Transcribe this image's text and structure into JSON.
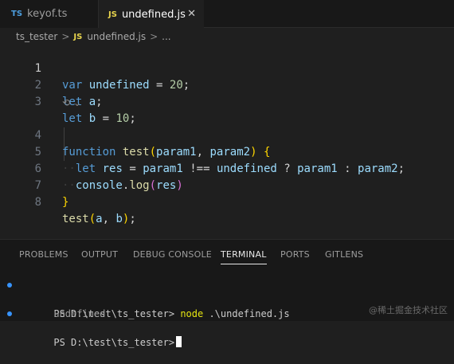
{
  "tabs": [
    {
      "badge": "TS",
      "label": "keyof.ts",
      "active": false
    },
    {
      "badge": "JS",
      "label": "undefined.js",
      "active": true,
      "close": "✕"
    }
  ],
  "breadcrumb": {
    "folder": "ts_tester",
    "sep": ">",
    "badge": "JS",
    "file": "undefined.js",
    "sep2": ">",
    "more": "..."
  },
  "editor": {
    "lines": [
      {
        "n": "1"
      },
      {
        "n": "2"
      },
      {
        "n": "3"
      },
      {
        "n": "4"
      },
      {
        "n": "5"
      },
      {
        "n": "6"
      },
      {
        "n": "7"
      },
      {
        "n": "8"
      }
    ],
    "tokens": {
      "l1": [
        "var",
        "undefined",
        "=",
        "20",
        ";"
      ],
      "l2": [
        "let",
        "a",
        ";"
      ],
      "l3": [
        "let",
        "b",
        "=",
        "10",
        ";"
      ],
      "l4": [
        "function",
        "test",
        "(",
        "param1",
        ",",
        "param2",
        ")",
        "{"
      ],
      "l5": [
        "let",
        "res",
        "=",
        "param1",
        "!==",
        "undefined",
        "?",
        "param1",
        ":",
        "param2",
        ";"
      ],
      "l6": [
        "console",
        ".",
        "log",
        "(",
        "res",
        ")"
      ],
      "l7": [
        "}"
      ],
      "l8": [
        "test",
        "(",
        "a",
        ",",
        "b",
        ")",
        ";"
      ]
    },
    "inlay_hint": "⟲ ⌄"
  },
  "panel": {
    "tabs": [
      {
        "label": "PROBLEMS",
        "active": false
      },
      {
        "label": "OUTPUT",
        "active": false
      },
      {
        "label": "DEBUG CONSOLE",
        "active": false
      },
      {
        "label": "TERMINAL",
        "active": true
      },
      {
        "label": "PORTS",
        "active": false
      },
      {
        "label": "GITLENS",
        "active": false
      }
    ],
    "terminal": {
      "prompt1": "PS D:\\test\\ts_tester>",
      "cmd": "node",
      "arg": ".\\undefined.js",
      "output": "undefined",
      "prompt2": "PS D:\\test\\ts_tester>"
    }
  },
  "watermark": "@稀土掘金技术社区",
  "colors": {
    "accent": "#3794ff",
    "keyword": "#569cd6",
    "function": "#dcdcaa",
    "number": "#b5cea8",
    "variable": "#9cdcfe"
  }
}
